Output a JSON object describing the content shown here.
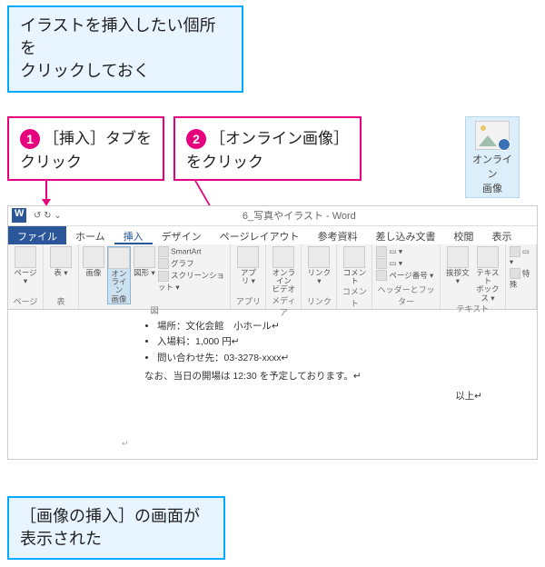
{
  "callouts": {
    "top": "イラストを挿入したい個所を\nクリックしておく",
    "step1_num": "❶",
    "step1": "［挿入］タブを\nクリック",
    "step2_num": "❷",
    "step2": "［オンライン画像］\nをクリック",
    "bottom": "［画像の挿入］の画面が\n表示された"
  },
  "preview_icon_label": "オンライン\n画像",
  "word": {
    "title": "6_写真やイラスト - Word",
    "qat": "↺ ↻ ⌄",
    "tabs": {
      "file": "ファイル",
      "home": "ホーム",
      "insert": "挿入",
      "design": "デザイン",
      "layout": "ページレイアウト",
      "ref": "参考資料",
      "mail": "差し込み文書",
      "review": "校閲",
      "view": "表示"
    },
    "ribbon": {
      "g_page": {
        "label": "ページ",
        "b1": "ページ ▾"
      },
      "g_table": {
        "label": "表",
        "b1": "表 ▾"
      },
      "g_illust": {
        "label": "図",
        "b_image": "画像",
        "b_online": "オンライン\n画像",
        "b_shape": "図形 ▾",
        "s1": "SmartArt",
        "s2": "グラフ",
        "s3": "スクリーンショット ▾"
      },
      "g_app": {
        "label": "アプリ",
        "b1": "アプ\nリ ▾"
      },
      "g_media": {
        "label": "メディア",
        "b1": "オンライン\nビデオ"
      },
      "g_link": {
        "label": "リンク",
        "b1": "リンク ▾"
      },
      "g_comment": {
        "label": "コメント",
        "b1": "コメント"
      },
      "g_hf": {
        "label": "ヘッダーとフッター",
        "s1": "▭ ▾",
        "s2": "▭ ▾",
        "s3": "ページ番号 ▾"
      },
      "g_text": {
        "label": "テキスト",
        "b1": "挨拶文 ▾",
        "b2": "テキスト\nボックス ▾"
      },
      "g_sym": {
        "label": "",
        "s1": "▭ ▾",
        "s2": "特殊"
      }
    },
    "doc": {
      "li2": "場所：文化会館　小ホール↵",
      "li3": "入場料：1,000 円↵",
      "li4": "問い合わせ先：03-3278-xxxx↵",
      "note": "なお、当日の開場は 12:30 を予定しております。↵",
      "end": "以上↵",
      "cursor": "↵"
    }
  }
}
